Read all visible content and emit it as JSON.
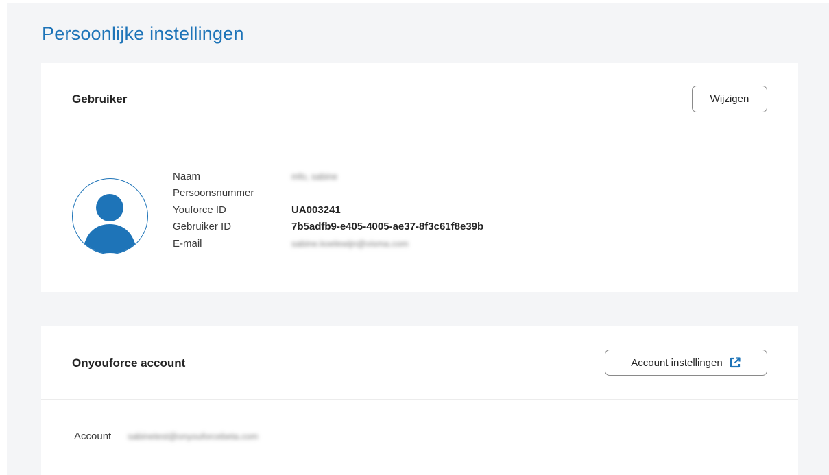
{
  "page": {
    "title": "Persoonlijke instellingen"
  },
  "user_card": {
    "title": "Gebruiker",
    "edit_button": "Wijzigen",
    "avatar_icon": "user-avatar-icon",
    "fields": [
      {
        "label": "Naam",
        "value": "mfo, sabine",
        "blurred": true
      },
      {
        "label": "Persoonsnummer",
        "value": ""
      },
      {
        "label": "Youforce ID",
        "value": "UA003241"
      },
      {
        "label": "Gebruiker ID",
        "value": "7b5adfb9-e405-4005-ae37-8f3c61f8e39b"
      },
      {
        "label": "E-mail",
        "value": "sabine.koelewijn@visma.com",
        "blurred": true
      }
    ]
  },
  "account_card": {
    "title": "Onyouforce account",
    "settings_button": "Account instellingen",
    "settings_icon": "external-link-icon",
    "account_label": "Account",
    "account_value": "sabinetest@onyouforcebeta.com"
  },
  "colors": {
    "accent": "#1e74b8",
    "page_background": "#f4f5f7",
    "card_background": "#ffffff"
  }
}
